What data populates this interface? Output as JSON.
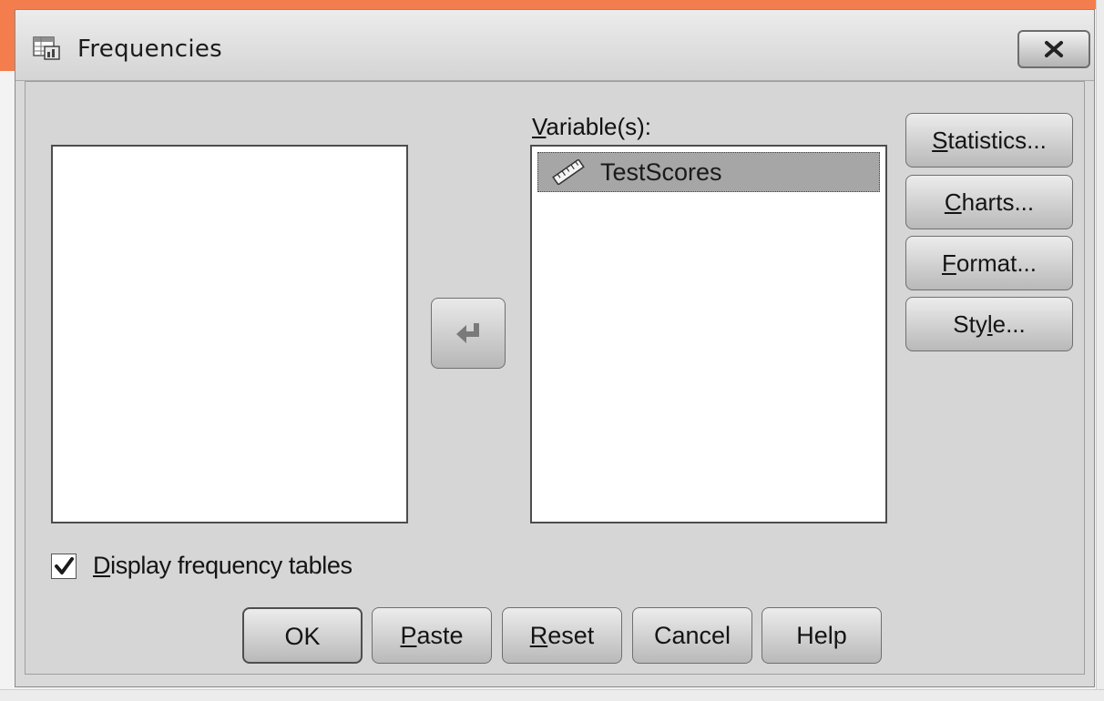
{
  "window": {
    "title": "Frequencies",
    "title_icon": "frequencies-table-icon",
    "close_icon": "close-icon"
  },
  "source_list": {
    "items": []
  },
  "target_list": {
    "label_mnemonic": "V",
    "label_rest": "ariable(s):",
    "items": [
      {
        "label": "TestScores",
        "icon": "scale-variable-icon",
        "selected": true
      }
    ]
  },
  "move_button": {
    "icon": "move-arrow-icon"
  },
  "side_buttons": {
    "statistics": {
      "mnemonic": "S",
      "rest": "tatistics..."
    },
    "charts": {
      "mnemonic": "C",
      "rest": "harts..."
    },
    "format": {
      "mnemonic": "F",
      "rest": "ormat..."
    },
    "style": {
      "before": "Sty",
      "mnemonic": "l",
      "rest": "e..."
    }
  },
  "display_frequency_tables": {
    "checked": true,
    "mnemonic": "D",
    "rest": "isplay frequency tables"
  },
  "bottom_buttons": {
    "ok": "OK",
    "paste": {
      "mnemonic": "P",
      "rest": "aste"
    },
    "reset": {
      "mnemonic": "R",
      "rest": "eset"
    },
    "cancel": "Cancel",
    "help": "Help"
  },
  "colors": {
    "accent": "#f47d4e",
    "dialog_background": "#d6d6d6",
    "selection": "#a6a6a6"
  }
}
